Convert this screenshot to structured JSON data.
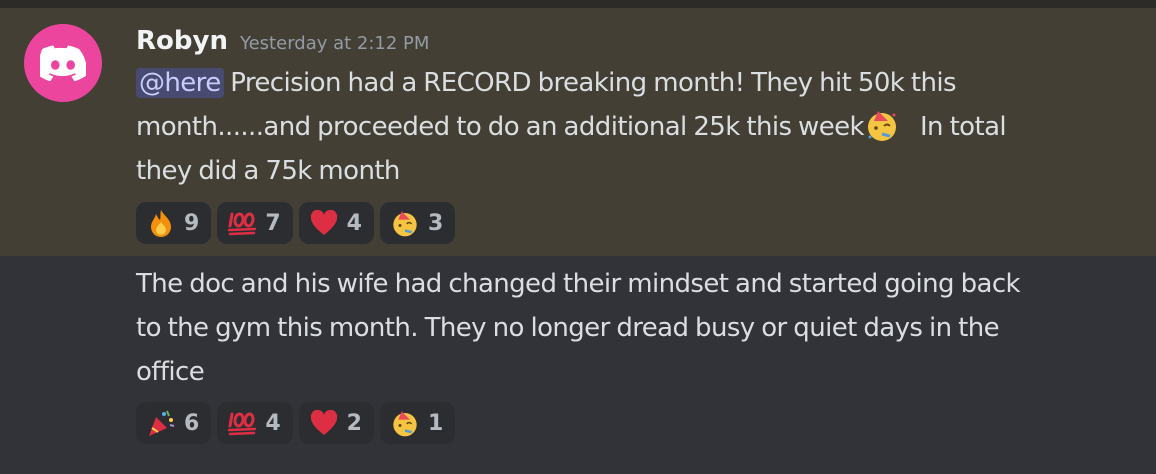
{
  "message1": {
    "author": "Robyn",
    "timestamp": "Yesterday at 2:12 PM",
    "mention": "@here",
    "line1_text": " Precision had a RECORD breaking month!  They hit 50k this",
    "line2_before_emoji": "month......and proceeded to do an additional 25k this week",
    "line2_after_emoji": "   In total",
    "line3_text": "they did a 75k month",
    "inline_emoji": "partying-face",
    "reactions": [
      {
        "emoji": "fire",
        "count": "9"
      },
      {
        "emoji": "hundred-points",
        "count": "7"
      },
      {
        "emoji": "red-heart",
        "count": "4"
      },
      {
        "emoji": "partying-face",
        "count": "3"
      }
    ]
  },
  "message2": {
    "line1_text": "The doc and his wife had changed their mindset and started going back",
    "line2_text": "to the gym this month.  They no longer dread busy or quiet days in the",
    "line3_text": "office",
    "reactions": [
      {
        "emoji": "party-popper",
        "count": "6"
      },
      {
        "emoji": "hundred-points",
        "count": "4"
      },
      {
        "emoji": "red-heart",
        "count": "2"
      },
      {
        "emoji": "partying-face",
        "count": "1"
      }
    ]
  },
  "colors": {
    "background": "#313338",
    "highlight": "#433f35",
    "avatar": "#eb459e",
    "reaction_bg": "#2b2d31",
    "mention_bg": "#5865f2"
  }
}
